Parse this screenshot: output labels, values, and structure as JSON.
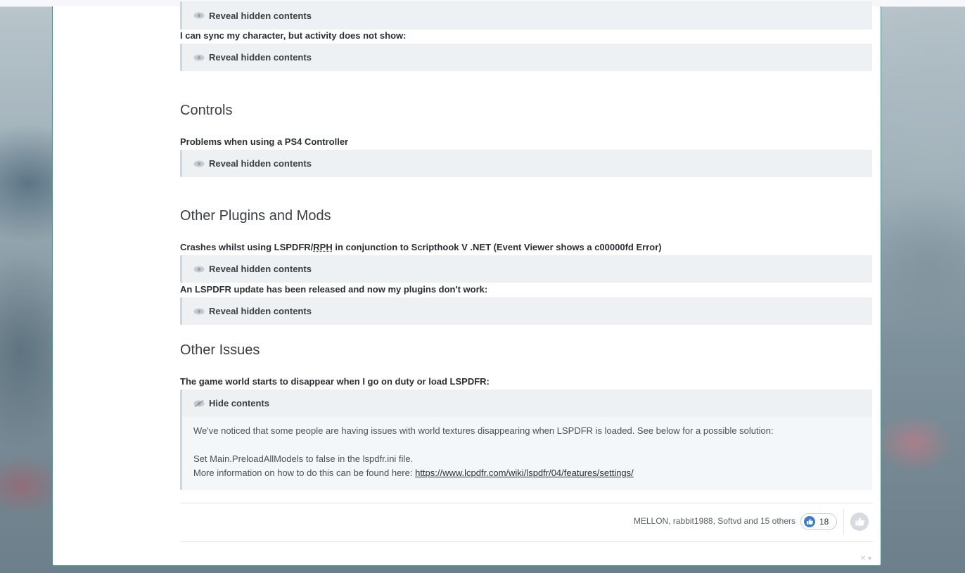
{
  "spoiler": {
    "reveal_label": "Reveal hidden contents",
    "hide_label": "Hide contents"
  },
  "sections": {
    "q_sync": "I can sync my character, but activity does not show:",
    "controls_title": "Controls",
    "q_ps4": "Problems when using a PS4 Controller",
    "plugins_title": "Other Plugins and Mods",
    "q_crash_a": "Crashes whilst using LSPDFR/",
    "q_crash_abbr": "RPH",
    "q_crash_b": " in conjunction to Scripthook V .NET (Event Viewer shows a c00000fd Error)",
    "q_update": "An LSPDFR update has been released and now my plugins don't work:",
    "other_title": "Other Issues",
    "q_world": "The game world starts to disappear when I go on duty or load LSPDFR:"
  },
  "revealed": {
    "line1": "We've noticed that some people are having issues with world textures disappearing when LSPDFR is loaded.  See below for a possible solution:",
    "line2": "Set Main.PreloadAllModels to false in the lspdfr.ini file.",
    "line3_prefix": "More information on how to do this can be found here: ",
    "link": "https://www.lcpdfr.com/wiki/lspdfr/04/features/settings/"
  },
  "reactions": {
    "names": "MELLON, rabbit1988, Softvd and 15 others",
    "count": "18",
    "like_icon": "thumbs-up-icon"
  },
  "colors": {
    "accent_border": "#4f8f85",
    "like_blue": "#3d7bd8"
  }
}
